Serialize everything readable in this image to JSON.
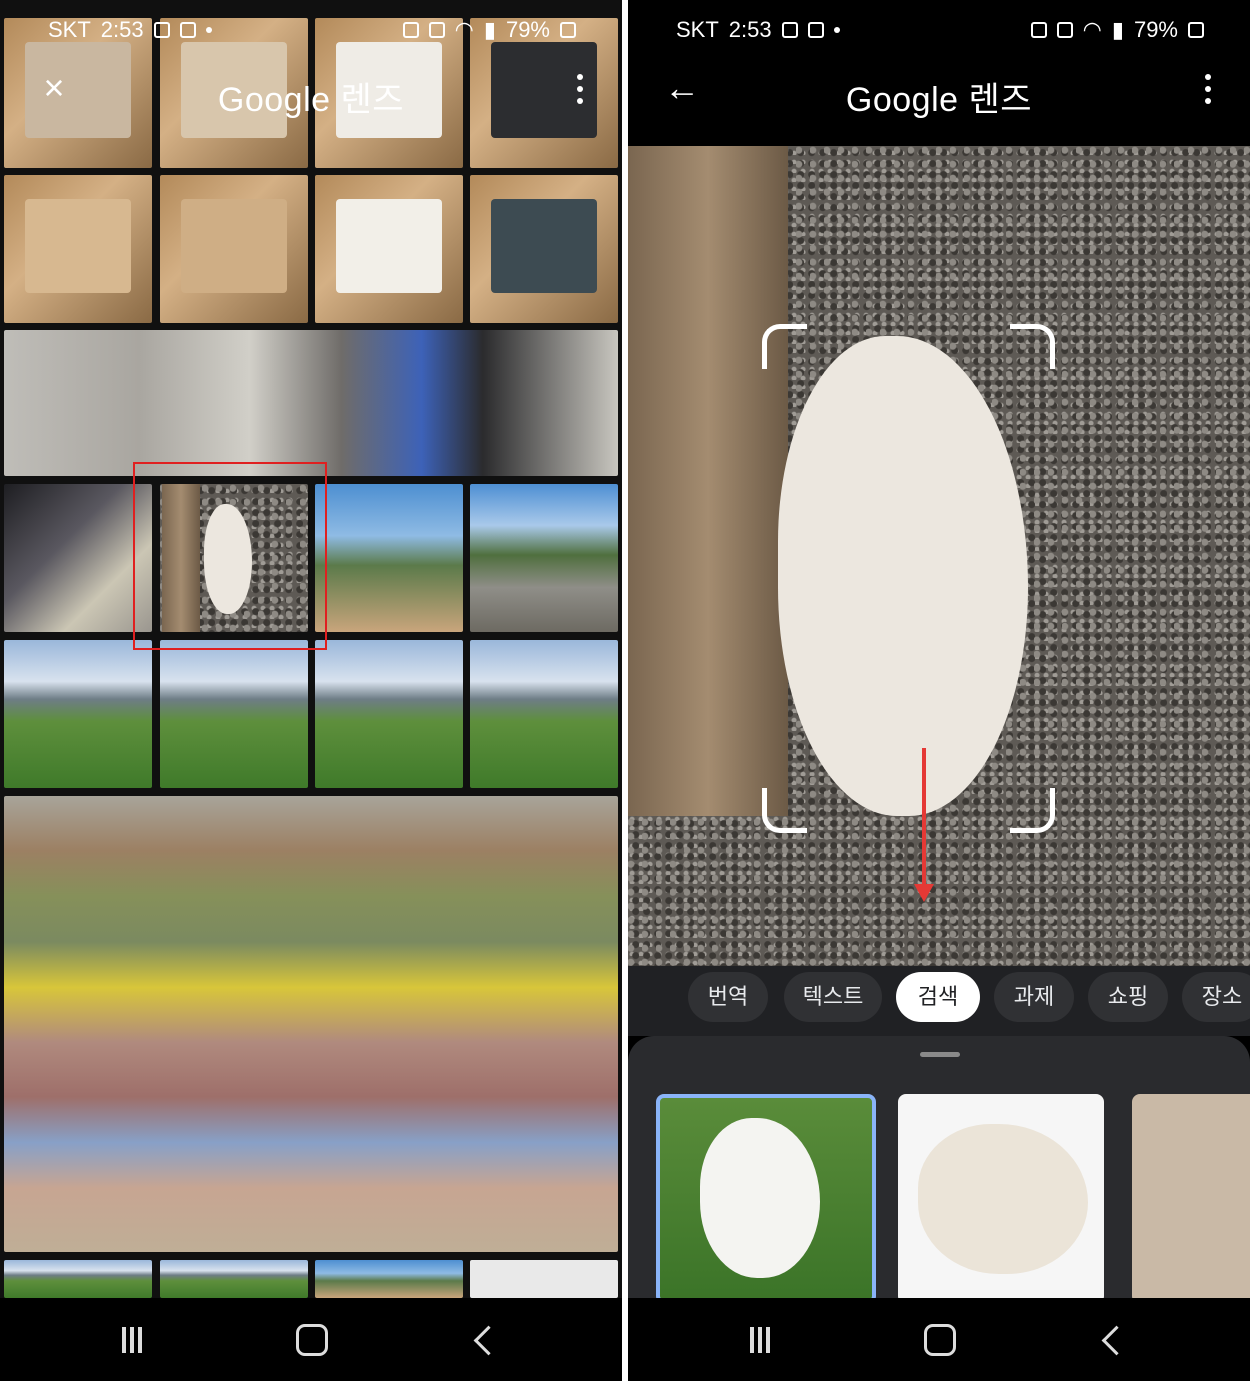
{
  "status_bar": {
    "carrier": "SKT",
    "time": "2:53",
    "battery": "79%"
  },
  "left_screen": {
    "title": "Google 렌즈",
    "close_icon": "×",
    "menu_icon": "more-vert-icon"
  },
  "right_screen": {
    "title": "Google 렌즈",
    "back_icon": "←",
    "menu_icon": "more-vert-icon",
    "chips": [
      {
        "label": "번역",
        "active": false
      },
      {
        "label": "텍스트",
        "active": false
      },
      {
        "label": "검색",
        "active": true
      },
      {
        "label": "과제",
        "active": false
      },
      {
        "label": "쇼핑",
        "active": false
      },
      {
        "label": "장소",
        "active": false
      }
    ]
  },
  "annotations": {
    "highlight_color": "#e02020",
    "arrow_color": "#e53935"
  },
  "colors": {
    "chip_active_bg": "#ffffff",
    "chip_bg": "#303134",
    "selected_result_border": "#8ab4f8"
  }
}
